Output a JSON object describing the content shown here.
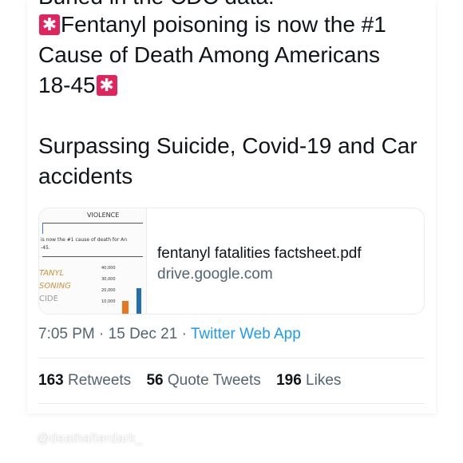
{
  "tweet": {
    "cut_top_text": "Buried in the CDC data:",
    "headline_part1": "Fentanyl poisoning is now the #1 Cause of Death Among Americans 18-45",
    "subline": "Surpassing Suicide, Covid-19 and Car accidents",
    "link_card": {
      "title": "fentanyl fatalities factsheet.pdf",
      "domain": "drive.google.com",
      "thumb": {
        "heading": "VIOLENCE",
        "caption": "is now the #1 cause of death for An",
        "caption2": "-45.",
        "list": [
          "TANYL",
          "SONING",
          "CIDE"
        ],
        "axis": [
          "40,000",
          "30,000",
          "20,000",
          "10,000"
        ]
      }
    },
    "time": "7:05 PM",
    "date": "15 Dec 21",
    "app": "Twitter Web App",
    "stats": {
      "retweets_count": "163",
      "retweets_label": "Retweets",
      "quotes_count": "56",
      "quotes_label": "Quote Tweets",
      "likes_count": "196",
      "likes_label": "Likes"
    }
  },
  "watermark": "@deathafterdark_",
  "colors": {
    "link": "#1d9bf0",
    "secondary": "#536471",
    "siren": "#e0245e",
    "bar_orange": "#e8761c",
    "bar_blue": "#1f6fb2"
  },
  "icons": {
    "siren": "police-car-light-icon"
  }
}
